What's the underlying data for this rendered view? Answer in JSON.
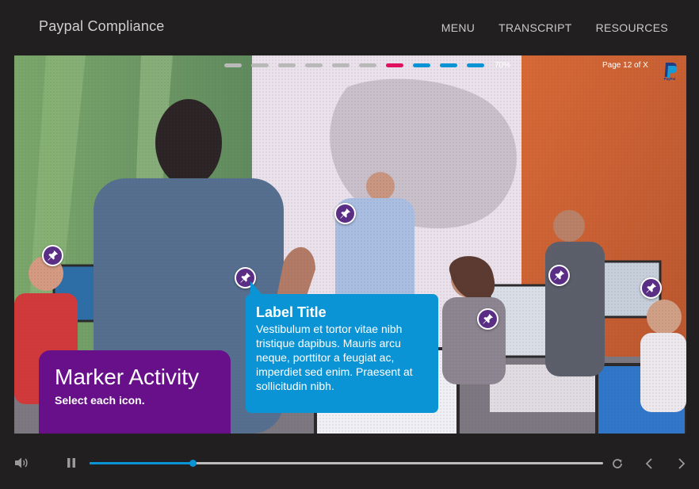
{
  "header": {
    "title": "Paypal Compliance",
    "nav": [
      {
        "label": "MENU"
      },
      {
        "label": "TRANSCRIPT"
      },
      {
        "label": "RESOURCES"
      }
    ]
  },
  "slide": {
    "progress": {
      "percent_label": "70%",
      "percent": 70,
      "dot_colors": [
        "#b9b9b9",
        "#b9b9b9",
        "#b9b9b9",
        "#b9b9b9",
        "#b9b9b9",
        "#b9b9b9",
        "#e0115f",
        "#0a94d6",
        "#0a94d6",
        "#0a94d6"
      ]
    },
    "page_indicator": "Page 12 of X",
    "logo_icon": "paypal-logo-icon",
    "marker_icon": "pushpin-icon",
    "marker_count": 7,
    "callout": {
      "title": "Label Title",
      "body": "Vestibulum et tortor vitae nibh tristique dapibus. Mauris arcu neque, porttitor a feugiat ac, imperdiet sed enim. Praesent at sollicitudin nibh."
    },
    "activity": {
      "title": "Marker Activity",
      "instruction": "Select each icon."
    }
  },
  "controls": {
    "seek_progress": 0.2,
    "icons": [
      "volume-icon",
      "pause-icon",
      "replay-icon",
      "previous-icon",
      "next-icon"
    ]
  },
  "colors": {
    "background": "#221f20",
    "accent_blue": "#0a94d6",
    "accent_purple": "#67108a",
    "marker_purple": "#5b2e85",
    "accent_pink": "#e0115f"
  }
}
